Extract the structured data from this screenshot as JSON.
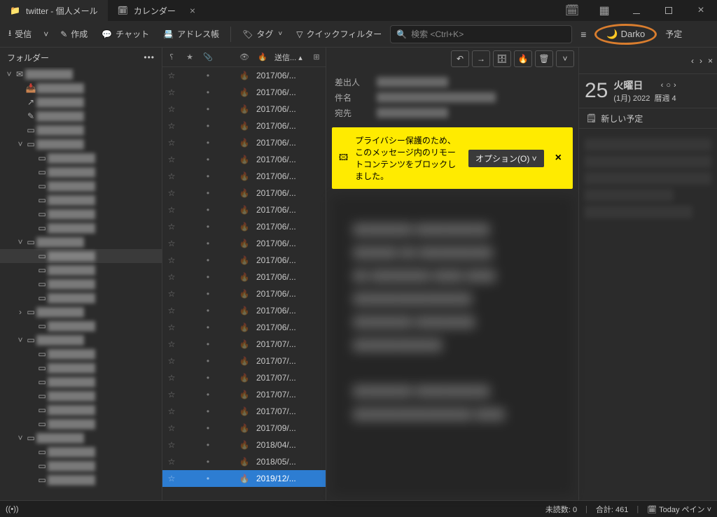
{
  "tabs": [
    {
      "label": "twitter - 個人メール",
      "active": true,
      "icon": "folder"
    },
    {
      "label": "カレンダー",
      "active": false,
      "icon": "calendar",
      "closable": true
    }
  ],
  "toolbar": {
    "receive": "受信",
    "compose": "作成",
    "chat": "チャット",
    "addressbook": "アドレス帳",
    "tag": "タグ",
    "quickfilter": "クイックフィルター",
    "search_placeholder": "検索 <Ctrl+K>",
    "darko": "Darko",
    "calendar_btn": "予定"
  },
  "folders": {
    "header": "フォルダー",
    "items": [
      {
        "depth": 0,
        "exp": true,
        "icon": "account"
      },
      {
        "depth": 1,
        "icon": "inbox"
      },
      {
        "depth": 1,
        "icon": "sent"
      },
      {
        "depth": 1,
        "icon": "draft"
      },
      {
        "depth": 1,
        "icon": "folder"
      },
      {
        "depth": 1,
        "exp": true,
        "icon": "folder"
      },
      {
        "depth": 2,
        "icon": "folder"
      },
      {
        "depth": 2,
        "icon": "folder"
      },
      {
        "depth": 2,
        "icon": "folder"
      },
      {
        "depth": 2,
        "icon": "folder"
      },
      {
        "depth": 2,
        "icon": "folder"
      },
      {
        "depth": 2,
        "icon": "folder"
      },
      {
        "depth": 1,
        "exp": true,
        "icon": "folder"
      },
      {
        "depth": 2,
        "icon": "folder",
        "sel": true
      },
      {
        "depth": 2,
        "icon": "folder"
      },
      {
        "depth": 2,
        "icon": "folder"
      },
      {
        "depth": 2,
        "icon": "folder"
      },
      {
        "depth": 1,
        "exp": false,
        "icon": "folder"
      },
      {
        "depth": 2,
        "icon": "folder"
      },
      {
        "depth": 1,
        "exp": true,
        "icon": "folder"
      },
      {
        "depth": 2,
        "icon": "folder"
      },
      {
        "depth": 2,
        "icon": "folder"
      },
      {
        "depth": 2,
        "icon": "folder"
      },
      {
        "depth": 2,
        "icon": "folder"
      },
      {
        "depth": 2,
        "icon": "folder"
      },
      {
        "depth": 2,
        "icon": "folder"
      },
      {
        "depth": 1,
        "exp": true,
        "icon": "folder"
      },
      {
        "depth": 2,
        "icon": "folder"
      },
      {
        "depth": 2,
        "icon": "folder"
      },
      {
        "depth": 2,
        "icon": "folder"
      }
    ]
  },
  "messages": {
    "date_col": "送信...",
    "rows": [
      "2017/06/...",
      "2017/06/...",
      "2017/06/...",
      "2017/06/...",
      "2017/06/...",
      "2017/06/...",
      "2017/06/...",
      "2017/06/...",
      "2017/06/...",
      "2017/06/...",
      "2017/06/...",
      "2017/06/...",
      "2017/06/...",
      "2017/06/...",
      "2017/06/...",
      "2017/06/...",
      "2017/07/...",
      "2017/07/...",
      "2017/07/...",
      "2017/07/...",
      "2017/07/...",
      "2017/09/...",
      "2018/04/...",
      "2018/05/..."
    ],
    "selected": {
      "date": "2019/12/..."
    }
  },
  "preview": {
    "from_label": "差出人",
    "subject_label": "件名",
    "to_label": "宛先",
    "notification": {
      "text": "プライバシー保護のため、このメッセージ内のリモートコンテンツをブロックしました。",
      "options_btn": "オプション(O)"
    }
  },
  "calendar": {
    "day_number": "25",
    "day_name": "火曜日",
    "month_year": "(1月) 2022",
    "week": "暦週 4",
    "new_event": "新しい予定"
  },
  "statusbar": {
    "unread_label": "未読数:",
    "unread_count": "0",
    "total_label": "合計:",
    "total_count": "461",
    "today_pane": "Today ペイン"
  }
}
